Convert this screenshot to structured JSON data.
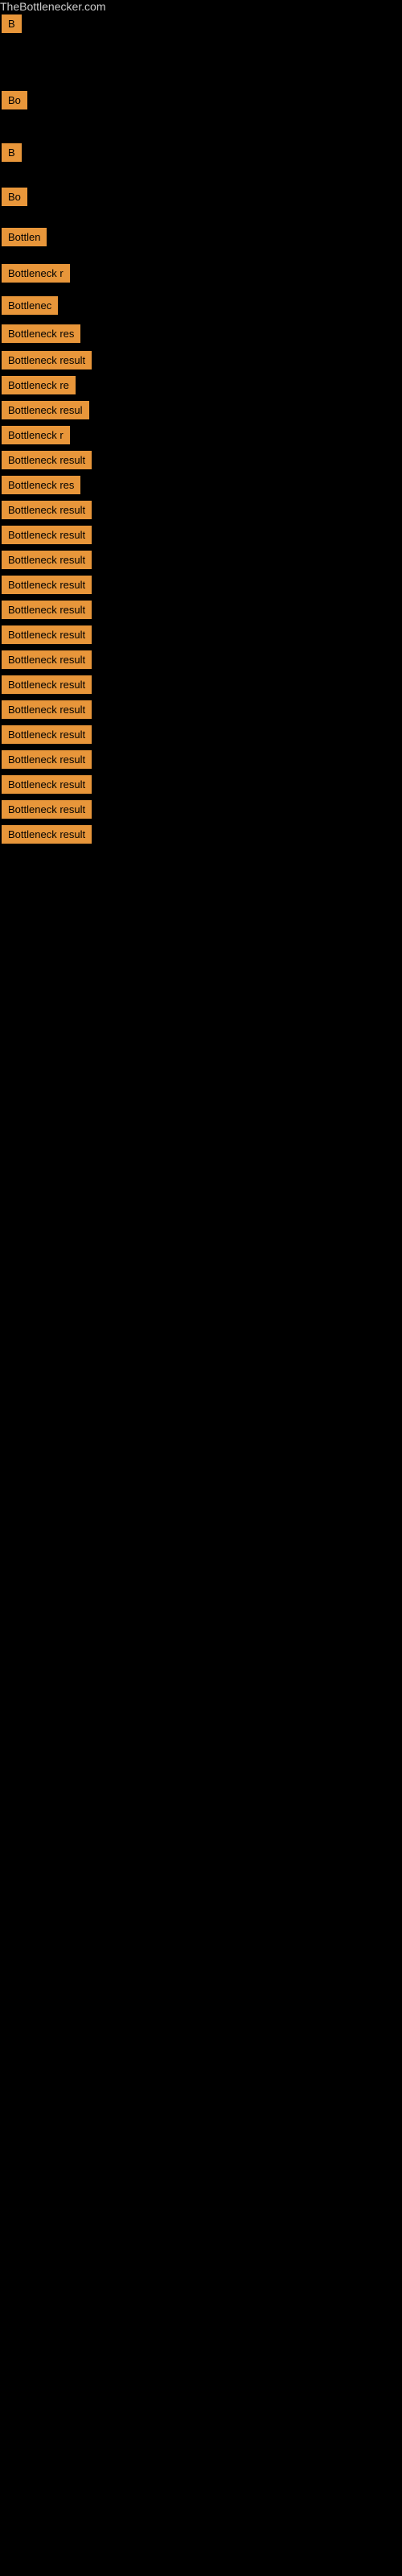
{
  "site": {
    "title": "TheBottlenecker.com"
  },
  "items": [
    {
      "id": 0,
      "label": "",
      "width": 2,
      "marginClass": "row-0"
    },
    {
      "id": 1,
      "label": "",
      "width": 2,
      "marginClass": "row-1"
    },
    {
      "id": 2,
      "label": "",
      "width": 2,
      "marginClass": "row-2"
    },
    {
      "id": 3,
      "label": "B",
      "width": 12,
      "marginClass": "row-3"
    },
    {
      "id": 4,
      "label": "Bo",
      "width": 20,
      "marginClass": "row-4"
    },
    {
      "id": 5,
      "label": "B",
      "width": 18,
      "marginClass": "row-5"
    },
    {
      "id": 6,
      "label": "Bo",
      "width": 20,
      "marginClass": "row-6"
    },
    {
      "id": 7,
      "label": "Bottlen",
      "width": 55,
      "marginClass": "row-7"
    },
    {
      "id": 8,
      "label": "Bottleneck r",
      "width": 90,
      "marginClass": "row-8"
    },
    {
      "id": 9,
      "label": "Bottlenec",
      "width": 75,
      "marginClass": "row-9"
    },
    {
      "id": 10,
      "label": "Bottleneck res",
      "width": 105,
      "marginClass": "row-10"
    },
    {
      "id": 11,
      "label": "Bottleneck result",
      "width": 122,
      "marginClass": "row-regular"
    },
    {
      "id": 12,
      "label": "Bottleneck re",
      "width": 100,
      "marginClass": "row-regular"
    },
    {
      "id": 13,
      "label": "Bottleneck resul",
      "width": 118,
      "marginClass": "row-regular"
    },
    {
      "id": 14,
      "label": "Bottleneck r",
      "width": 90,
      "marginClass": "row-regular"
    },
    {
      "id": 15,
      "label": "Bottleneck result",
      "width": 122,
      "marginClass": "row-regular"
    },
    {
      "id": 16,
      "label": "Bottleneck res",
      "width": 105,
      "marginClass": "row-regular"
    },
    {
      "id": 17,
      "label": "Bottleneck result",
      "width": 122,
      "marginClass": "row-regular"
    },
    {
      "id": 18,
      "label": "Bottleneck result",
      "width": 122,
      "marginClass": "row-regular"
    },
    {
      "id": 19,
      "label": "Bottleneck result",
      "width": 122,
      "marginClass": "row-regular"
    },
    {
      "id": 20,
      "label": "Bottleneck result",
      "width": 122,
      "marginClass": "row-regular"
    },
    {
      "id": 21,
      "label": "Bottleneck result",
      "width": 122,
      "marginClass": "row-regular"
    },
    {
      "id": 22,
      "label": "Bottleneck result",
      "width": 122,
      "marginClass": "row-regular"
    },
    {
      "id": 23,
      "label": "Bottleneck result",
      "width": 122,
      "marginClass": "row-regular"
    },
    {
      "id": 24,
      "label": "Bottleneck result",
      "width": 122,
      "marginClass": "row-regular"
    },
    {
      "id": 25,
      "label": "Bottleneck result",
      "width": 122,
      "marginClass": "row-regular"
    },
    {
      "id": 26,
      "label": "Bottleneck result",
      "width": 122,
      "marginClass": "row-regular"
    },
    {
      "id": 27,
      "label": "Bottleneck result",
      "width": 122,
      "marginClass": "row-regular"
    },
    {
      "id": 28,
      "label": "Bottleneck result",
      "width": 122,
      "marginClass": "row-regular"
    },
    {
      "id": 29,
      "label": "Bottleneck result",
      "width": 122,
      "marginClass": "row-regular"
    },
    {
      "id": 30,
      "label": "Bottleneck result",
      "width": 122,
      "marginClass": "row-regular"
    }
  ]
}
